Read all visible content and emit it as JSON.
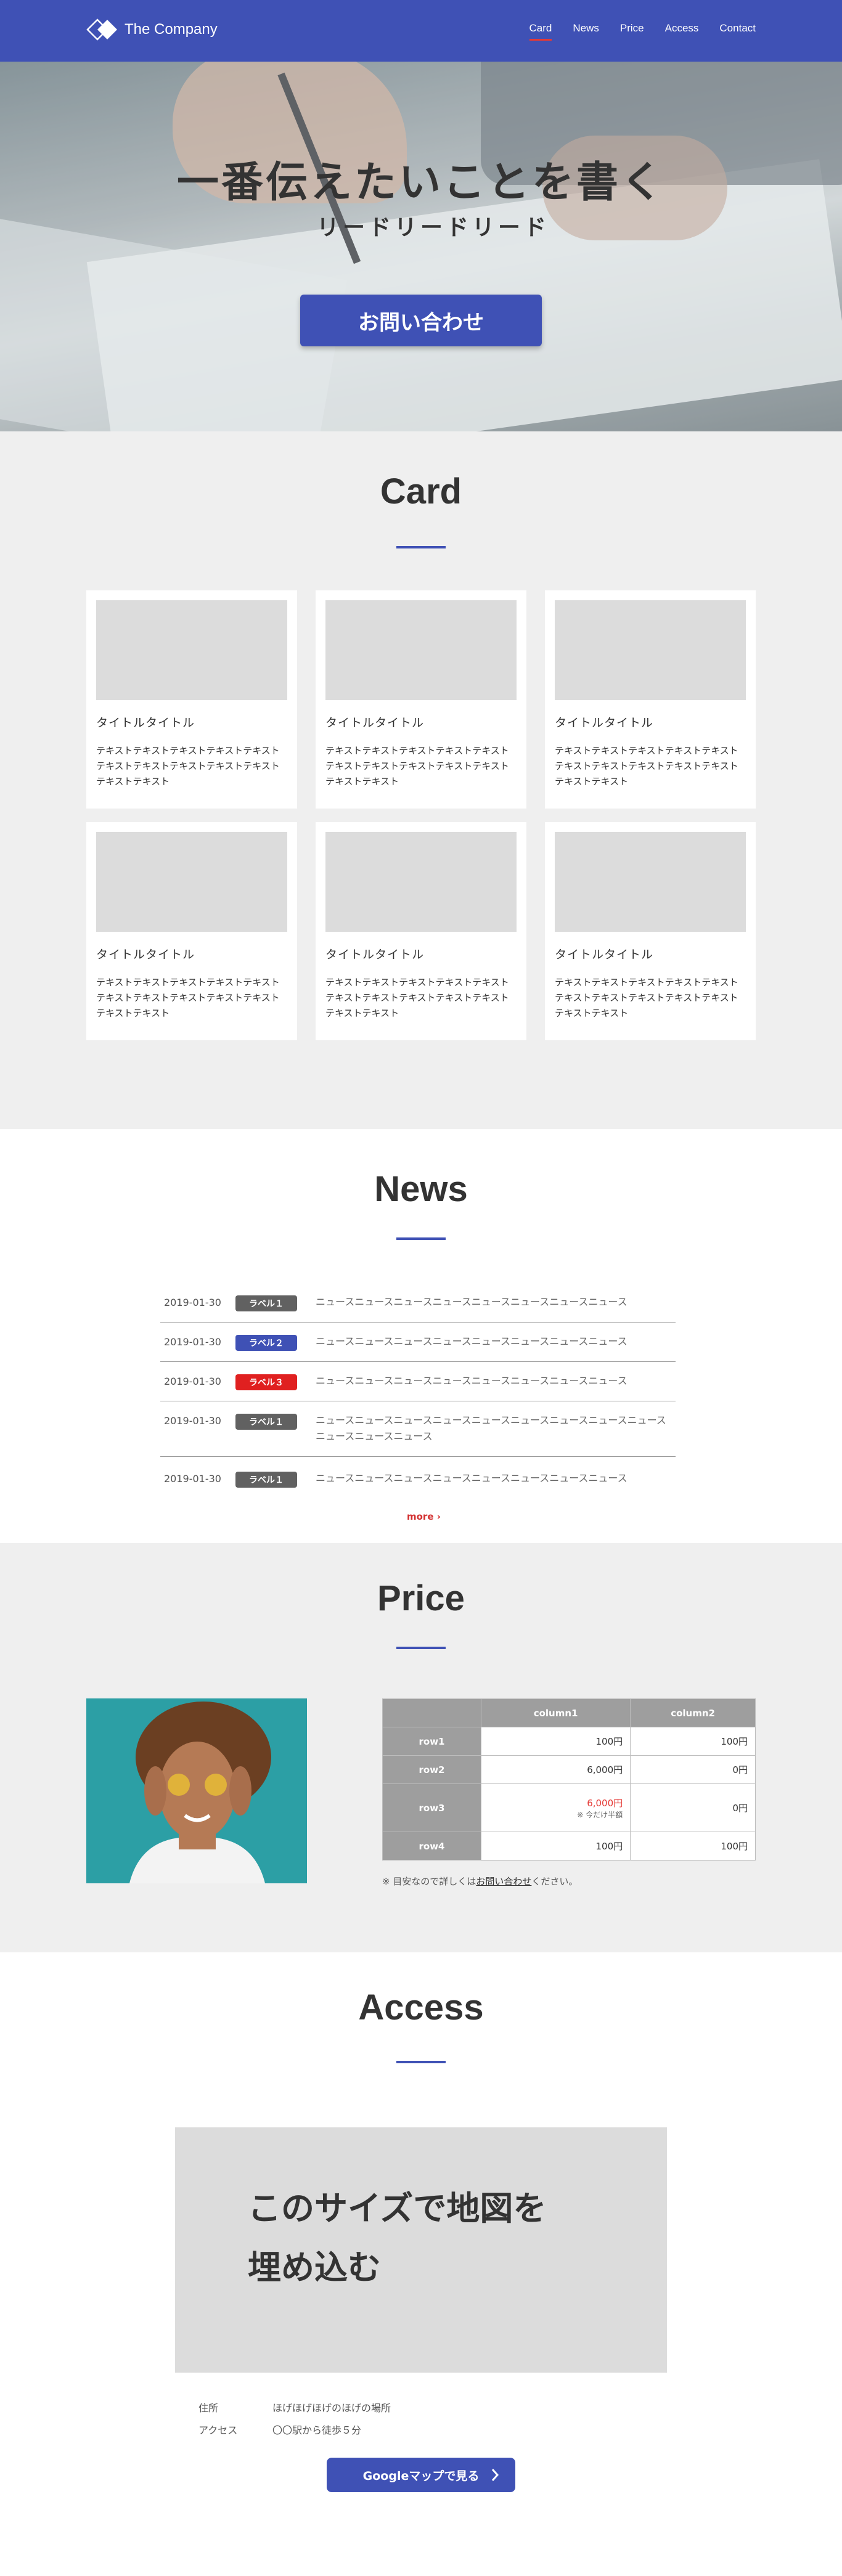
{
  "header": {
    "logo_text": "The Company",
    "nav": [
      "Card",
      "News",
      "Price",
      "Access",
      "Contact"
    ],
    "active_nav": "Card"
  },
  "hero": {
    "title": "一番伝えたいことを書く",
    "lead": "リードリードリード",
    "cta": "お問い合わせ"
  },
  "card_section": {
    "title": "Card",
    "cards": [
      {
        "title": "タイトルタイトル",
        "text": "テキストテキストテキストテキストテキストテキストテキストテキストテキストテキストテキストテキスト"
      },
      {
        "title": "タイトルタイトル",
        "text": "テキストテキストテキストテキストテキストテキストテキストテキストテキストテキストテキストテキスト"
      },
      {
        "title": "タイトルタイトル",
        "text": "テキストテキストテキストテキストテキストテキストテキストテキストテキストテキストテキストテキスト"
      },
      {
        "title": "タイトルタイトル",
        "text": "テキストテキストテキストテキストテキストテキストテキストテキストテキストテキストテキストテキスト"
      },
      {
        "title": "タイトルタイトル",
        "text": "テキストテキストテキストテキストテキストテキストテキストテキストテキストテキストテキストテキスト"
      },
      {
        "title": "タイトルタイトル",
        "text": "テキストテキストテキストテキストテキストテキストテキストテキストテキストテキストテキストテキスト"
      }
    ]
  },
  "news_section": {
    "title": "News",
    "items": [
      {
        "date": "2019-01-30",
        "label": "ラベル１",
        "label_color": "#616161",
        "text": "ニュースニュースニュースニュースニュースニュースニュースニュース"
      },
      {
        "date": "2019-01-30",
        "label": "ラベル２",
        "label_color": "#3f51b5",
        "text": "ニュースニュースニュースニュースニュースニュースニュースニュース"
      },
      {
        "date": "2019-01-30",
        "label": "ラベル３",
        "label_color": "#e02020",
        "text": "ニュースニュースニュースニュースニュースニュースニュースニュース"
      },
      {
        "date": "2019-01-30",
        "label": "ラベル１",
        "label_color": "#616161",
        "text": "ニュースニュースニュースニュースニュースニュースニュースニュースニュースニュースニュースニュース"
      },
      {
        "date": "2019-01-30",
        "label": "ラベル１",
        "label_color": "#616161",
        "text": "ニュースニュースニュースニュースニュースニュースニュースニュース"
      }
    ],
    "more": "more"
  },
  "price_section": {
    "title": "Price",
    "columns": [
      "column1",
      "column2"
    ],
    "rows": [
      {
        "name": "row1",
        "c1": "100円",
        "c2": "100円"
      },
      {
        "name": "row2",
        "c1": "6,000円",
        "c2": "0円"
      },
      {
        "name": "row3",
        "c1": "6,000円",
        "c1_note": "※ 今だけ半額",
        "c2": "0円"
      },
      {
        "name": "row4",
        "c1": "100円",
        "c2": "100円"
      }
    ],
    "note_prefix": "※ 目安なので詳しくは",
    "note_link": "お問い合わせ",
    "note_suffix": "ください。"
  },
  "access_section": {
    "title": "Access",
    "map_placeholder": "このサイズで地図を\n埋め込む",
    "address_label": "住所",
    "address_value": "ほげほげほげのほげの場所",
    "access_label": "アクセス",
    "access_value": "〇〇駅から徒歩５分",
    "button": "Googleマップで見る"
  },
  "colors": {
    "primary": "#3f51b5",
    "accent_red": "#e53935",
    "section_bg": "#efefef"
  }
}
